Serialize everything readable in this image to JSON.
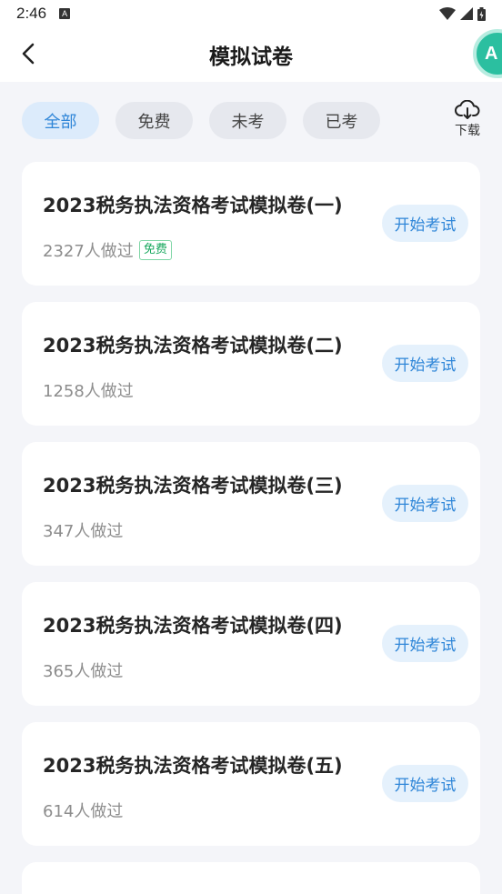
{
  "status_bar": {
    "time": "2:46",
    "notification_badge": "A"
  },
  "header": {
    "title": "模拟试卷",
    "avatar_letter": "A",
    "avatar_color": "#2bbfa0"
  },
  "filters": {
    "tabs": [
      {
        "label": "全部",
        "active": true
      },
      {
        "label": "免费",
        "active": false
      },
      {
        "label": "未考",
        "active": false
      },
      {
        "label": "已考",
        "active": false
      }
    ],
    "download_label": "下载"
  },
  "colors": {
    "accent": "#2f86d8",
    "free_tag": "#1aa85f",
    "background": "#f4f5f9"
  },
  "papers": [
    {
      "title": "2023税务执法资格考试模拟卷(一)",
      "done_count": "2327人做过",
      "free_tag": "免费",
      "action_label": "开始考试"
    },
    {
      "title": "2023税务执法资格考试模拟卷(二)",
      "done_count": "1258人做过",
      "action_label": "开始考试"
    },
    {
      "title": "2023税务执法资格考试模拟卷(三)",
      "done_count": "347人做过",
      "action_label": "开始考试"
    },
    {
      "title": "2023税务执法资格考试模拟卷(四)",
      "done_count": "365人做过",
      "action_label": "开始考试"
    },
    {
      "title": "2023税务执法资格考试模拟卷(五)",
      "done_count": "614人做过",
      "action_label": "开始考试"
    }
  ]
}
